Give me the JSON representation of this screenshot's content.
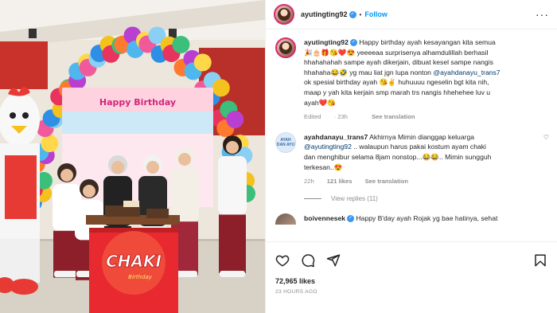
{
  "post": {
    "author": "ayutingting92",
    "follow_label": "Follow",
    "dot": "•",
    "caption_lines": [
      "Happy birthday ayah kesayangan kita semua",
      "🎉🎂🎁😘❤️😍 yeeeeaa surprisenya alhamdulillah berhasil",
      "hhahahahah sampe ayah dikerjain, dibuat kesel sampe nangis",
      "hhahaha😂🤣 yg mau liat jgn lupa nonton",
      "ok spesial birthday ayah 😘✌️ huhuuuu ngeselin bgt kita nih,",
      "maap y yah kita kerjain smp marah trs nangis hhehehee luv u",
      "ayah❤️😘"
    ],
    "caption_mention": "@ayahdanayu_trans7",
    "caption_edited": "Edited",
    "caption_time": "23h",
    "see_translation": "See translation"
  },
  "comment1": {
    "avatar_text": "AYAH DAN AYU",
    "user": "ayahdanayu_trans7",
    "lines": [
      "Akhirnya Mimin dianggap keluarga",
      ".. walaupun harus pakai kostum ayam chaki",
      "dan menghibur selama 8jam nonstop...😂😂.. Mimin sungguh",
      "terkesan..😍"
    ],
    "mention": "@ayutingting92",
    "time": "22h",
    "likes": "121 likes",
    "see_translation": "See translation",
    "view_replies": "View replies (11)"
  },
  "comment2": {
    "user": "boivennesek",
    "text": "Happy B'day ayah Rojak yg bae hatinya, sehat"
  },
  "footer": {
    "likes": "72,965 likes",
    "time_ago": "23 HOURS AGO"
  },
  "icons": {
    "header_more": "more-icon",
    "like": "heart-icon",
    "comment": "comment-icon",
    "share": "share-icon",
    "save": "bookmark-icon"
  },
  "photo_text": {
    "banner": "Happy Birthday",
    "podium": "CHAKI",
    "podium_sub": "Birthday"
  },
  "colors": {
    "accent": "#0095f6",
    "mention": "#00376b",
    "podium": "#e8292f"
  }
}
